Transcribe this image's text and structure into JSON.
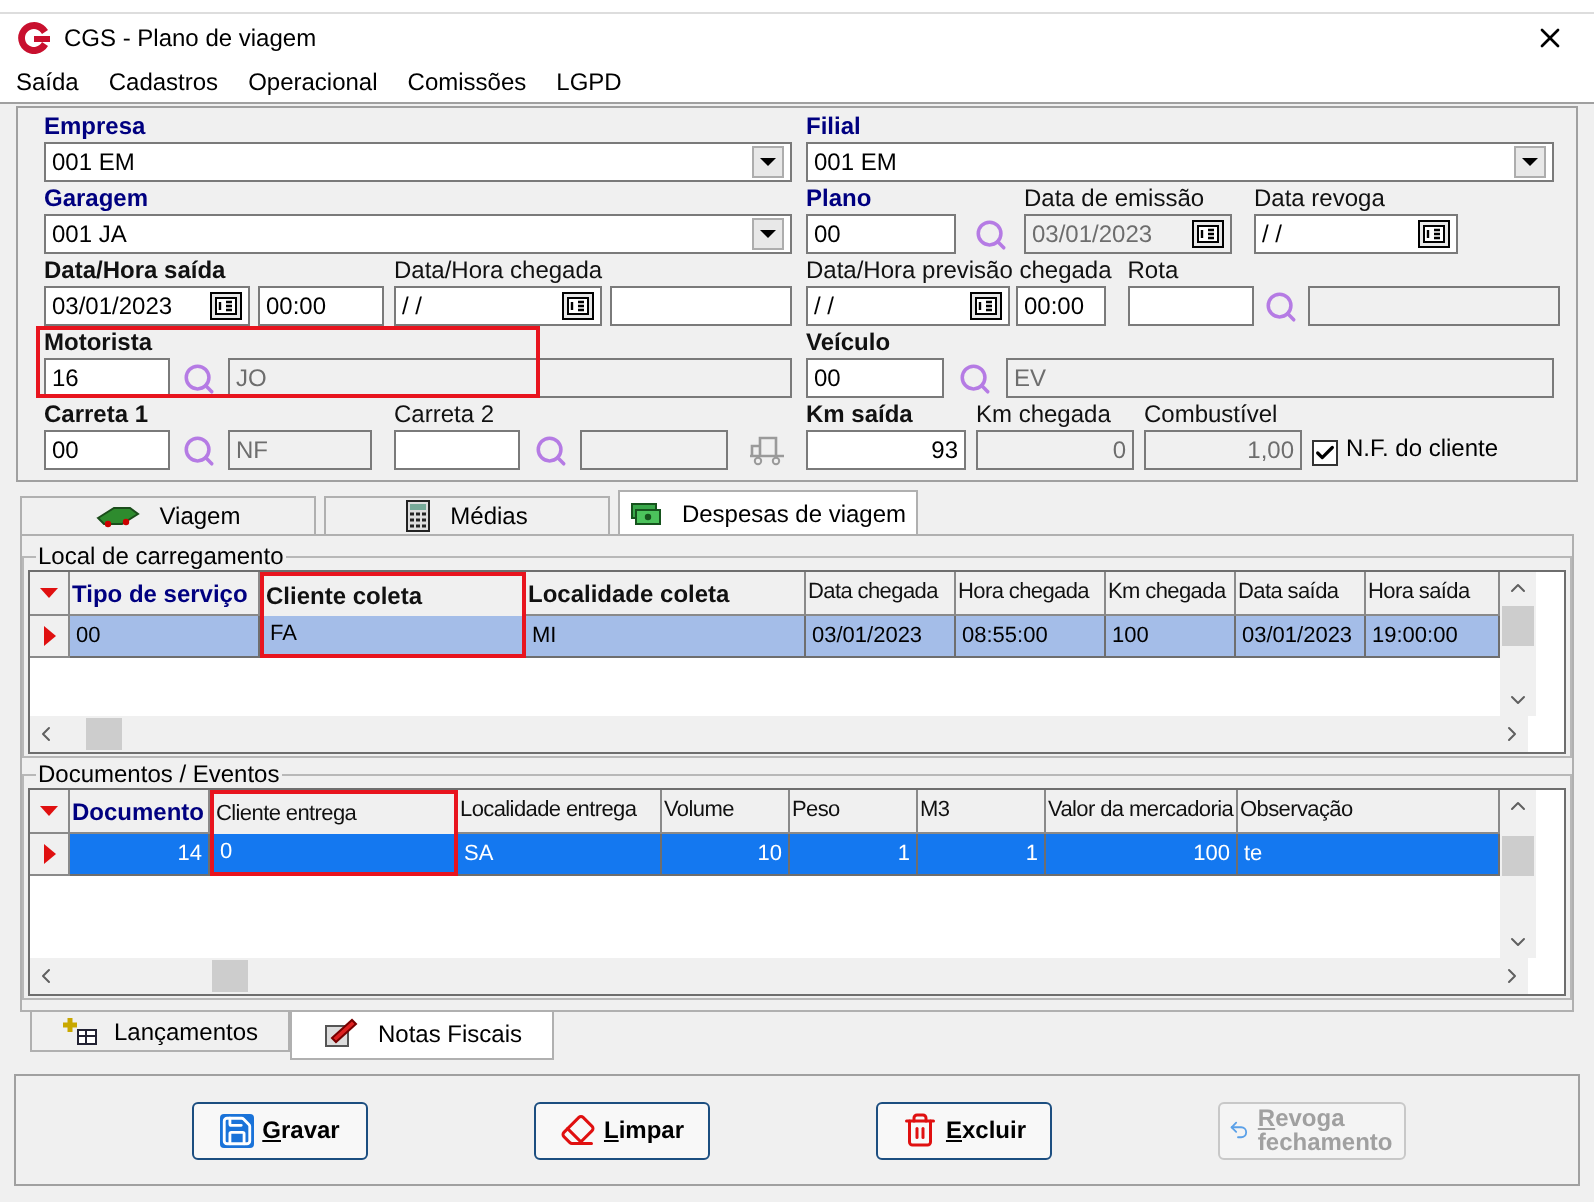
{
  "window": {
    "title": "CGS - Plano de viagem"
  },
  "menu": [
    "Saída",
    "Cadastros",
    "Operacional",
    "Comissões",
    "LGPD"
  ],
  "form": {
    "empresa": {
      "label": "Empresa",
      "required": true,
      "bold": true,
      "value": "001 EM"
    },
    "filial": {
      "label": "Filial",
      "required": true,
      "bold": true,
      "value": "001 EM"
    },
    "garagem": {
      "label": "Garagem",
      "required": true,
      "bold": true,
      "value": "001 JA"
    },
    "plano": {
      "label": "Plano",
      "required": true,
      "bold": true,
      "value": "00"
    },
    "data_emissao": {
      "label": "Data de emissão",
      "required": false,
      "bold": false,
      "value": "03/01/2023",
      "disabled": true
    },
    "data_revoga": {
      "label": "Data revoga",
      "required": false,
      "bold": false,
      "value": "/ /",
      "disabled": false
    },
    "saida": {
      "label": "Data/Hora saída",
      "required": false,
      "bold": true,
      "date": "03/01/2023",
      "time": "00:00"
    },
    "chegada": {
      "label": "Data/Hora chegada",
      "required": false,
      "bold": false,
      "date": "/ /"
    },
    "previsao": {
      "label": "Data/Hora previsão chegada",
      "required": false,
      "bold": false,
      "date": "/ /",
      "time": "00:00"
    },
    "rota": {
      "label": "Rota",
      "required": false,
      "bold": false
    },
    "motorista": {
      "label": "Motorista",
      "required": false,
      "bold": true,
      "code": "16",
      "name": "JO",
      "highlighted": true
    },
    "veiculo": {
      "label": "Veículo",
      "required": false,
      "bold": true,
      "code": "00",
      "name": "EV"
    },
    "carreta1": {
      "label": "Carreta 1",
      "required": false,
      "bold": true,
      "code": "00",
      "name": "NF"
    },
    "carreta2": {
      "label": "Carreta 2",
      "required": false,
      "bold": false
    },
    "km_saida": {
      "label": "Km saída",
      "required": false,
      "bold": true,
      "value": "93"
    },
    "km_chegada": {
      "label": "Km chegada",
      "required": false,
      "bold": false,
      "value": "0",
      "disabled": true
    },
    "combustivel": {
      "label": "Combustível",
      "required": false,
      "bold": false,
      "value": "1,00",
      "disabled": true
    },
    "nf_cliente": {
      "label": "N.F. do cliente",
      "checked": true
    }
  },
  "tabs": [
    {
      "label": "Viagem",
      "selected": false
    },
    {
      "label": "Médias",
      "selected": false
    },
    {
      "label": "Despesas de viagem",
      "selected": true
    }
  ],
  "loading": {
    "title": "Local de carregamento",
    "focused": false,
    "columns": [
      {
        "label": "Tipo de serviço",
        "required": true,
        "bold": true,
        "highlighted": false
      },
      {
        "label": "Cliente coleta",
        "required": false,
        "bold": true,
        "highlighted": true
      },
      {
        "label": "Localidade coleta",
        "required": false,
        "bold": true,
        "highlighted": false
      },
      {
        "label": "Data chegada",
        "required": false,
        "bold": false,
        "highlighted": false
      },
      {
        "label": "Hora chegada",
        "required": false,
        "bold": false,
        "highlighted": false
      },
      {
        "label": "Km chegada",
        "required": false,
        "bold": false,
        "highlighted": false
      },
      {
        "label": "Data saída",
        "required": false,
        "bold": false,
        "highlighted": false
      },
      {
        "label": "Hora saída",
        "required": false,
        "bold": false,
        "highlighted": false
      }
    ],
    "rows": [
      {
        "selected": true,
        "cells": [
          "00",
          "FA",
          "MI",
          "03/01/2023",
          "08:55:00",
          "100",
          "03/01/2023",
          "19:00:00"
        ]
      }
    ]
  },
  "documents": {
    "title": "Documentos / Eventos",
    "focused": true,
    "columns": [
      {
        "label": "Documento",
        "required": true,
        "bold": true,
        "highlighted": false
      },
      {
        "label": "Cliente entrega",
        "required": false,
        "bold": false,
        "highlighted": true
      },
      {
        "label": "Localidade entrega",
        "required": false,
        "bold": false,
        "highlighted": false
      },
      {
        "label": "Volume",
        "required": false,
        "bold": false,
        "highlighted": false
      },
      {
        "label": "Peso",
        "required": false,
        "bold": false,
        "highlighted": false
      },
      {
        "label": "M3",
        "required": false,
        "bold": false,
        "highlighted": false
      },
      {
        "label": "Valor da mercadoria",
        "required": false,
        "bold": false,
        "highlighted": false
      },
      {
        "label": "Observação",
        "required": false,
        "bold": false,
        "highlighted": false
      }
    ],
    "rows": [
      {
        "selected": true,
        "cells": [
          "14",
          "0",
          "SA",
          "10",
          "1",
          "1",
          "100",
          "te"
        ]
      }
    ]
  },
  "bottom_tabs": [
    {
      "label": "Lançamentos",
      "selected": false
    },
    {
      "label": "Notas Fiscais",
      "selected": true
    }
  ],
  "buttons": [
    {
      "label": "Gravar",
      "disabled": false
    },
    {
      "label": "Limpar",
      "disabled": false
    },
    {
      "label": "Excluir",
      "disabled": false
    },
    {
      "label": "Revoga fechamento",
      "disabled": true
    }
  ]
}
